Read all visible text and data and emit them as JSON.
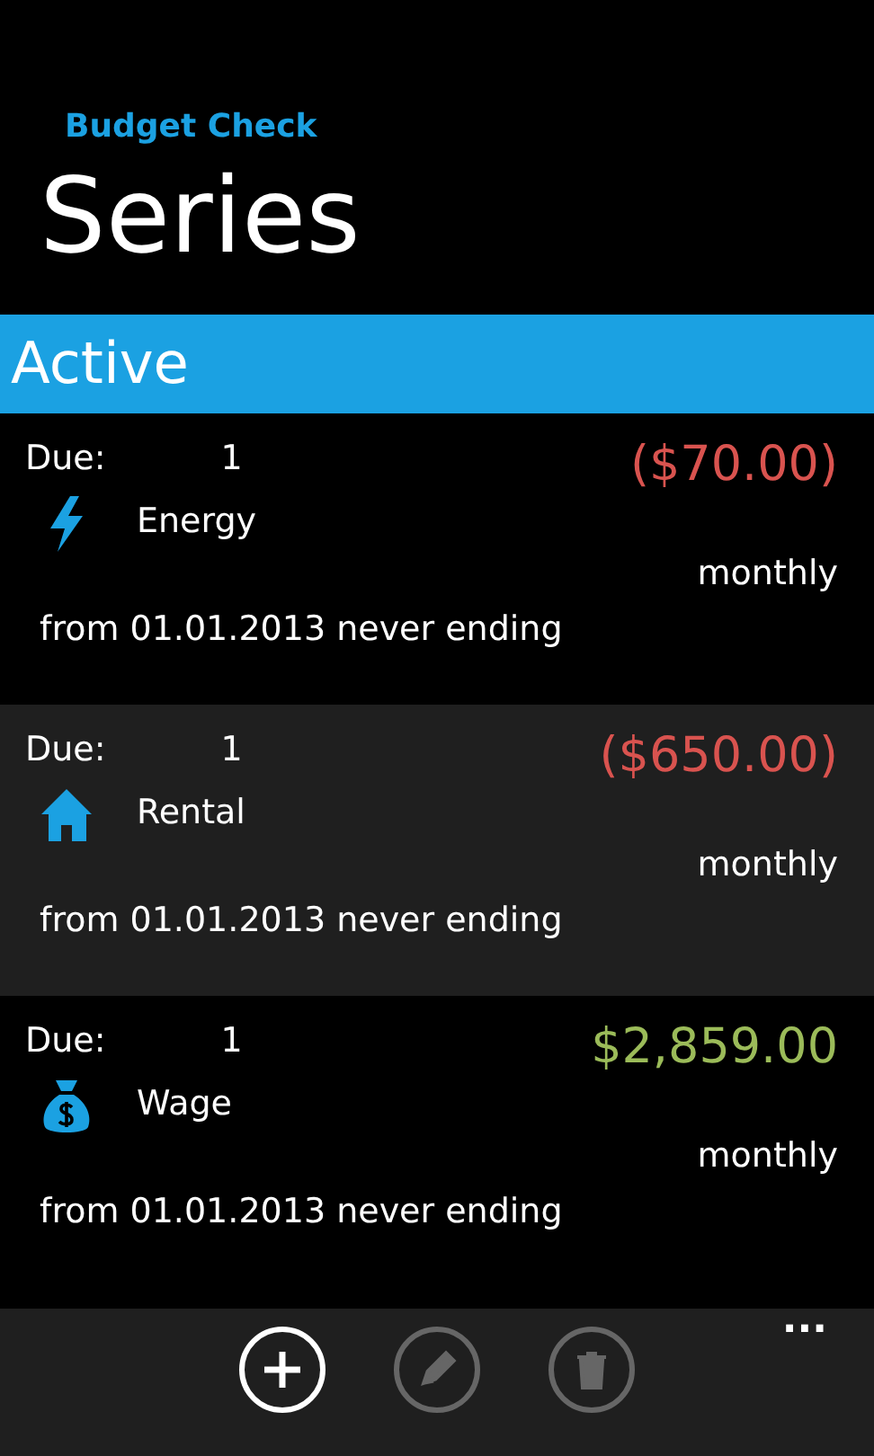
{
  "app_title": "Budget Check",
  "page_title": "Series",
  "group": {
    "title": "Active"
  },
  "items": [
    {
      "due_label": "Due:",
      "due": "1",
      "amount": "($70.00)",
      "negative": true,
      "kind": "energy",
      "category": "Energy",
      "frequency": "monthly",
      "period": "from 01.01.2013 never ending"
    },
    {
      "due_label": "Due:",
      "due": "1",
      "amount": "($650.00)",
      "negative": true,
      "kind": "house",
      "category": "Rental",
      "frequency": "monthly",
      "period": "from 01.01.2013 never ending"
    },
    {
      "due_label": "Due:",
      "due": "1",
      "amount": "$2,859.00",
      "negative": false,
      "kind": "money",
      "category": "Wage",
      "frequency": "monthly",
      "period": "from 01.01.2013 never ending"
    }
  ],
  "app_bar": {
    "buttons": [
      {
        "kind": "add",
        "disabled": false
      },
      {
        "kind": "edit",
        "disabled": true
      },
      {
        "kind": "delete",
        "disabled": true
      }
    ],
    "more": "..."
  }
}
